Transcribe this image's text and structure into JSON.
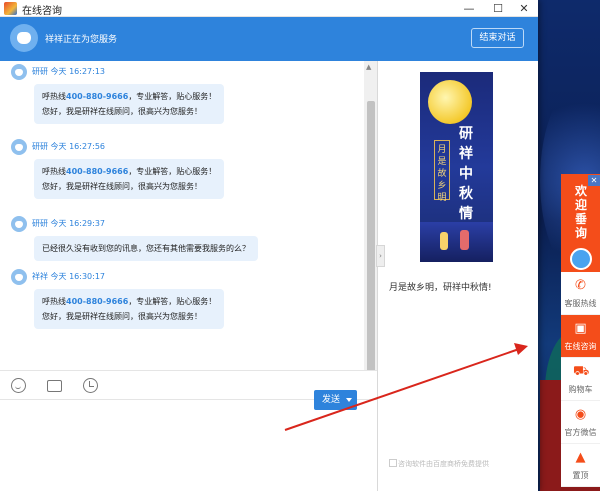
{
  "window": {
    "title": "在线咨询",
    "minimize": "—",
    "maximize": "☐",
    "close": "✕"
  },
  "header": {
    "status": "祥祥正在为您服务",
    "end_button": "结束对话"
  },
  "messages": [
    {
      "name_time": "研研 今天 16:27:13",
      "line1_prefix": "呼热线",
      "phone": "400-880-9666",
      "line1_suffix": "，专业解答，贴心服务！",
      "line2": "您好，我是研祥在线顾问，很高兴为您服务！"
    },
    {
      "name_time": "研研 今天 16:27:56",
      "line1_prefix": "呼热线",
      "phone": "400-880-9666",
      "line1_suffix": "，专业解答，贴心服务！",
      "line2": "您好，我是研祥在线顾问，很高兴为您服务！"
    },
    {
      "name_time": "研研 今天 16:29:37",
      "line1": "已经很久没有收到您的讯息，您还有其他需要我服务的么？"
    },
    {
      "name_time": "祥祥 今天 16:30:17",
      "line1_prefix": "呼热线",
      "phone": "400-880-9666",
      "line1_suffix": "，专业解答，贴心服务！",
      "line2": "您好，我是研祥在线顾问，很高兴为您服务！"
    }
  ],
  "composer": {
    "send_button": "发送"
  },
  "side_panel": {
    "poster_title": "研祥中秋情",
    "poster_subtitle": "月是故乡明",
    "caption": "月是故乡明，研祥中秋情!",
    "footer": "咨询软件由百度商桥免费提供"
  },
  "sidebar_widget": {
    "welcome": "欢迎垂询",
    "close": "✕",
    "items": [
      {
        "icon": "phone-icon",
        "glyph": "✆",
        "label": "客服热线"
      },
      {
        "icon": "chat-icon",
        "glyph": "▣",
        "label": "在线咨询",
        "active": true
      },
      {
        "icon": "cart-icon",
        "glyph": "⛟",
        "label": "购物车"
      },
      {
        "icon": "wechat-icon",
        "glyph": "◉",
        "label": "官方微信"
      },
      {
        "icon": "top-icon",
        "glyph": "▲",
        "label": "置顶"
      }
    ]
  },
  "colors": {
    "accent": "#2e83dc",
    "widget": "#f44d1a",
    "annotation_arrow": "#d9261c"
  }
}
